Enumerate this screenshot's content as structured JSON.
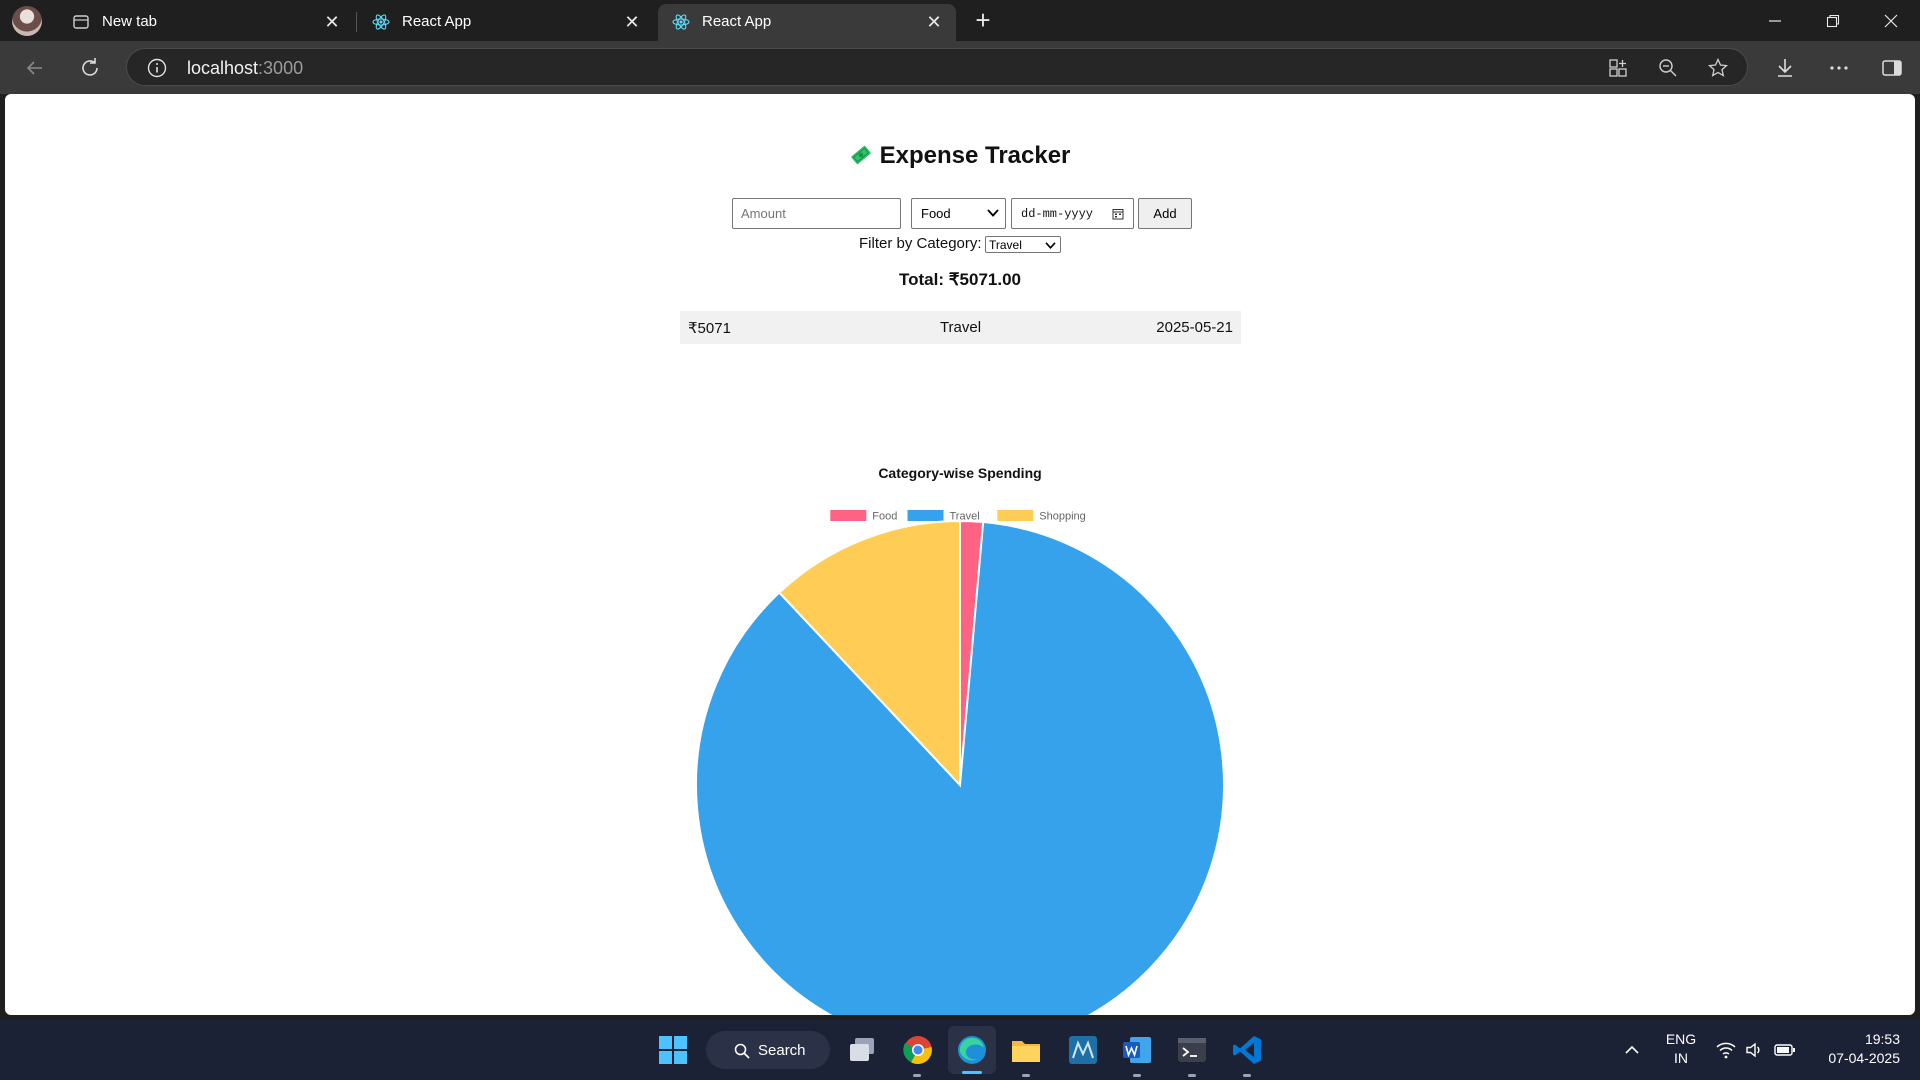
{
  "browser": {
    "tabs": [
      {
        "title": "New tab",
        "icon": "page-icon",
        "active": false
      },
      {
        "title": "React App",
        "icon": "react-icon",
        "active": false
      },
      {
        "title": "React App",
        "icon": "react-icon",
        "active": true
      }
    ],
    "address": {
      "host": "localhost",
      "port": ":3000"
    }
  },
  "app": {
    "title": "Expense Tracker",
    "title_icon": "money-icon",
    "form": {
      "amount_placeholder": "Amount",
      "category_value": "Food",
      "date_placeholder": "dd-mm-yyyy",
      "add_label": "Add"
    },
    "filter": {
      "label": "Filter by Category:",
      "value": "Travel"
    },
    "total_label": "Total: ₹5071.00",
    "expenses": [
      {
        "amount": "₹5071",
        "category": "Travel",
        "date": "2025-05-21"
      }
    ]
  },
  "chart_data": {
    "type": "pie",
    "title": "Category-wise Spending",
    "legend_position": "top",
    "categories": [
      "Food",
      "Travel",
      "Shopping"
    ],
    "values": [
      1.4,
      86.6,
      12.0
    ],
    "colors": [
      "#ff6384",
      "#36a2eb",
      "#ffcd56"
    ]
  },
  "taskbar": {
    "search_label": "Search",
    "lang_line1": "ENG",
    "lang_line2": "IN",
    "time": "19:53",
    "date": "07-04-2025",
    "apps": [
      "windows-start-icon",
      "search-icon",
      "task-view-icon",
      "chrome-icon",
      "edge-icon",
      "file-explorer-icon",
      "mysql-workbench-icon",
      "word-icon",
      "terminal-icon",
      "vscode-icon"
    ]
  }
}
